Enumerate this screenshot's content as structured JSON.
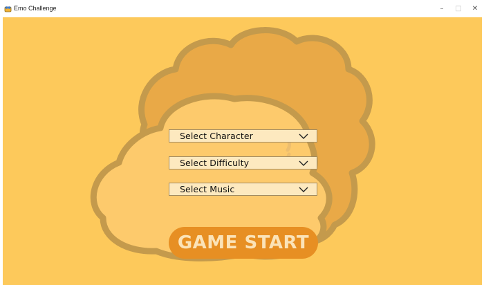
{
  "window": {
    "title": "Emo Challenge",
    "minimize_glyph": "–",
    "maximize_glyph": "□",
    "close_glyph": "✕",
    "icon": "app-icon"
  },
  "menu": {
    "character_label": "Select Character",
    "difficulty_label": "Select Difficulty",
    "music_label": "Select Music",
    "start_label": "GAME START"
  },
  "colors": {
    "background": "#fdc95b",
    "blob_back": "#e9a947",
    "blob_front": "#fdca6c",
    "outline": "#c49a4c",
    "dropdown_fill": "#fde9bf",
    "start_button": "#e78f23",
    "start_text": "#fbe3b8"
  }
}
